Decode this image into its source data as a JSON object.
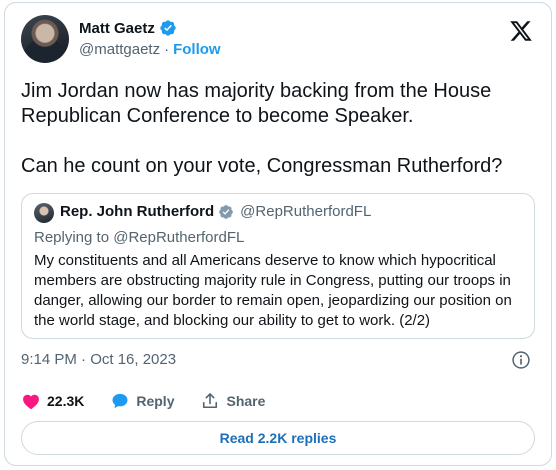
{
  "author": {
    "name": "Matt Gaetz",
    "handle": "@mattgaetz",
    "separator": "·",
    "follow_label": "Follow"
  },
  "tweet": {
    "text": "Jim Jordan now has majority backing from the House Republican Conference to become Speaker.\n\nCan he count on your vote, Congressman Rutherford?",
    "timestamp": "9:14 PM · Oct 16, 2023"
  },
  "quoted": {
    "name": "Rep. John Rutherford",
    "handle": "@RepRutherfordFL",
    "replying_to": "Replying to @RepRutherfordFL",
    "text": "My constituents and all Americans deserve to know which hypocritical members are obstructing majority rule in Congress, putting our troops in danger, allowing our border to remain open, jeopardizing our position on the world stage, and blocking our ability to get to work. (2/2)"
  },
  "actions": {
    "likes": "22.3K",
    "reply_label": "Reply",
    "share_label": "Share"
  },
  "read_replies_label": "Read 2.2K replies",
  "icons": {
    "verified": "verified-badge-icon",
    "x_logo": "x-logo-icon",
    "info": "info-icon",
    "like": "heart-icon",
    "reply": "speech-bubble-icon",
    "share": "upload-arrow-icon"
  },
  "colors": {
    "accent": "#1d9bf0",
    "like": "#f91880",
    "muted": "#536471",
    "text": "#0f1419",
    "border": "#cfd9de"
  }
}
